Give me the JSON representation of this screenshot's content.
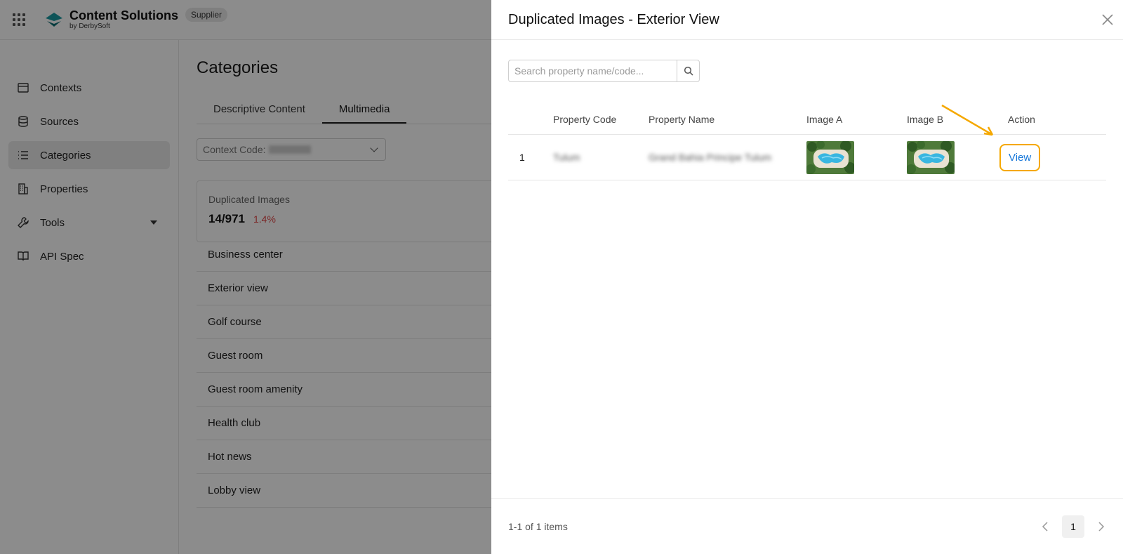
{
  "app": {
    "brand_title": "Content Solutions",
    "brand_sub": "by DerbySoft",
    "role_badge": "Supplier"
  },
  "sidebar": {
    "items": [
      {
        "label": "Contexts",
        "icon": "store-icon"
      },
      {
        "label": "Sources",
        "icon": "database-icon"
      },
      {
        "label": "Categories",
        "icon": "list-icon",
        "active": true
      },
      {
        "label": "Properties",
        "icon": "building-icon"
      },
      {
        "label": "Tools",
        "icon": "wrench-icon"
      },
      {
        "label": "API Spec",
        "icon": "book-icon"
      }
    ]
  },
  "main": {
    "title": "Categories",
    "tabs": [
      "Descriptive Content",
      "Multimedia"
    ],
    "context_label": "Context Code:",
    "dup_card": {
      "label": "Duplicated Images",
      "count": "14/971",
      "percent": "1.4%"
    },
    "categories": [
      "Business center",
      "Exterior view",
      "Golf course",
      "Guest room",
      "Guest room amenity",
      "Health club",
      "Hot news",
      "Lobby view"
    ]
  },
  "drawer": {
    "title": "Duplicated Images - Exterior View",
    "search_placeholder": "Search property name/code...",
    "columns": [
      "Property Code",
      "Property Name",
      "Image A",
      "Image B",
      "Action"
    ],
    "rows": [
      {
        "index": "1",
        "code": "Tulum",
        "name": "Grand Bahia Principe Tulum",
        "action": "View"
      }
    ],
    "footer_count": "1-1 of 1 items",
    "current_page": "1"
  },
  "colors": {
    "accent_link": "#1677d9",
    "highlight": "#f5a800",
    "danger": "#e04a4a",
    "brand": "#1a9aa0"
  }
}
